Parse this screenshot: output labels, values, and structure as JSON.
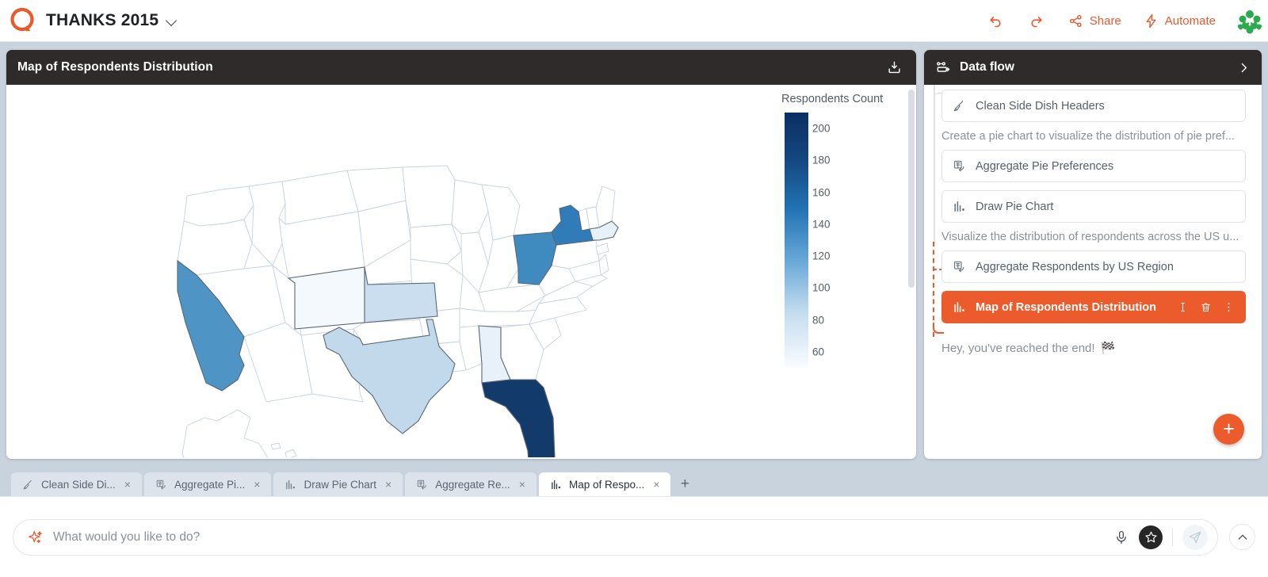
{
  "topbar": {
    "logo_icon": "q-logo-icon",
    "app_title": "THANKS 2015",
    "title_caret_icon": "chevron-down-icon",
    "undo_icon": "undo-icon",
    "redo_icon": "redo-icon",
    "share_label": "Share",
    "share_icon": "share-network-icon",
    "automate_label": "Automate",
    "automate_icon": "lightning-bolt-icon",
    "avatar_icon": "user-avatar"
  },
  "map_panel": {
    "title": "Map of Respondents Distribution",
    "download_icon": "download-icon"
  },
  "chart_data": {
    "type": "map",
    "title": "Map of Respondents Distribution",
    "legend_title": "Respondents Count",
    "legend_position": "right",
    "color_scale": [
      "#f7fbff",
      "#6aa9d6",
      "#1b5ea8",
      "#0b2f63"
    ],
    "value_range": [
      50,
      210
    ],
    "tick_labels": [
      "200",
      "180",
      "160",
      "140",
      "120",
      "100",
      "80",
      "60"
    ],
    "tick_values": [
      200,
      180,
      160,
      140,
      120,
      100,
      80,
      60
    ],
    "regions": [
      {
        "code": "FL",
        "name": "Florida",
        "value": 205,
        "color": "#123a6b"
      },
      {
        "code": "CA",
        "name": "California",
        "value": 150,
        "color": "#4e94c4"
      },
      {
        "code": "NY",
        "name": "New York",
        "value": 152,
        "color": "#2f7cb8"
      },
      {
        "code": "OH",
        "name": "Ohio",
        "value": 148,
        "color": "#3f8bc0"
      },
      {
        "code": "TX",
        "name": "Texas",
        "value": 112,
        "color": "#c2d9ec"
      },
      {
        "code": "KS",
        "name": "Kansas",
        "value": 108,
        "color": "#cadef0"
      },
      {
        "code": "AL",
        "name": "Alabama",
        "value": 68,
        "color": "#e8f1fa"
      },
      {
        "code": "MA",
        "name": "Massachusetts",
        "value": 66,
        "color": "#e8f1fa"
      },
      {
        "code": "CO",
        "name": "Colorado",
        "value": 58,
        "color": "#f4f9fd"
      }
    ]
  },
  "flow_panel": {
    "title": "Data flow",
    "header_icon": "data-flow-icon",
    "collapse_icon": "chevron-right-icon",
    "end_message": "Hey, you've reached the end!",
    "end_emoji": "🏁",
    "add_button_label": "+",
    "items": [
      {
        "kind": "node",
        "icon": "broom-icon",
        "label": "Clean Side Dish Headers",
        "selected": false
      },
      {
        "kind": "desc",
        "label": "Create a pie chart to visualize the distribution of pie pref..."
      },
      {
        "kind": "node",
        "icon": "table-transform-icon",
        "label": "Aggregate Pie Preferences",
        "selected": false
      },
      {
        "kind": "node",
        "icon": "bar-chart-icon",
        "label": "Draw Pie Chart",
        "selected": false
      },
      {
        "kind": "desc",
        "label": "Visualize the distribution of respondents across the US u..."
      },
      {
        "kind": "node",
        "icon": "table-transform-icon",
        "label": "Aggregate Respondents by US Region",
        "selected": false
      },
      {
        "kind": "node",
        "icon": "bar-chart-icon",
        "label": "Map of Respondents Distribution",
        "selected": true,
        "actions": [
          "rename-icon",
          "delete-icon",
          "more-options-icon"
        ]
      }
    ]
  },
  "tabbar": {
    "add_tab_label": "+",
    "tabs": [
      {
        "icon": "broom-icon",
        "label": "Clean Side Di...",
        "active": false,
        "close": "×"
      },
      {
        "icon": "table-transform-icon",
        "label": "Aggregate Pi...",
        "active": false,
        "close": "×"
      },
      {
        "icon": "bar-chart-icon",
        "label": "Draw Pie Chart",
        "active": false,
        "close": "×"
      },
      {
        "icon": "table-transform-icon",
        "label": "Aggregate Re...",
        "active": false,
        "close": "×"
      },
      {
        "icon": "bar-chart-icon",
        "label": "Map of Respo...",
        "active": true,
        "close": "×"
      }
    ]
  },
  "promptbar": {
    "sparkle_icon": "sparkle-icon",
    "placeholder": "What would you like to do?",
    "value": "",
    "mic_icon": "microphone-icon",
    "star_icon": "star-icon",
    "send_icon": "send-icon",
    "collapse_icon": "chevron-up-icon"
  },
  "colors": {
    "accent": "#ec5b2b",
    "panel_header": "#2e2b2a",
    "workspace_bg": "#c9d3de"
  }
}
